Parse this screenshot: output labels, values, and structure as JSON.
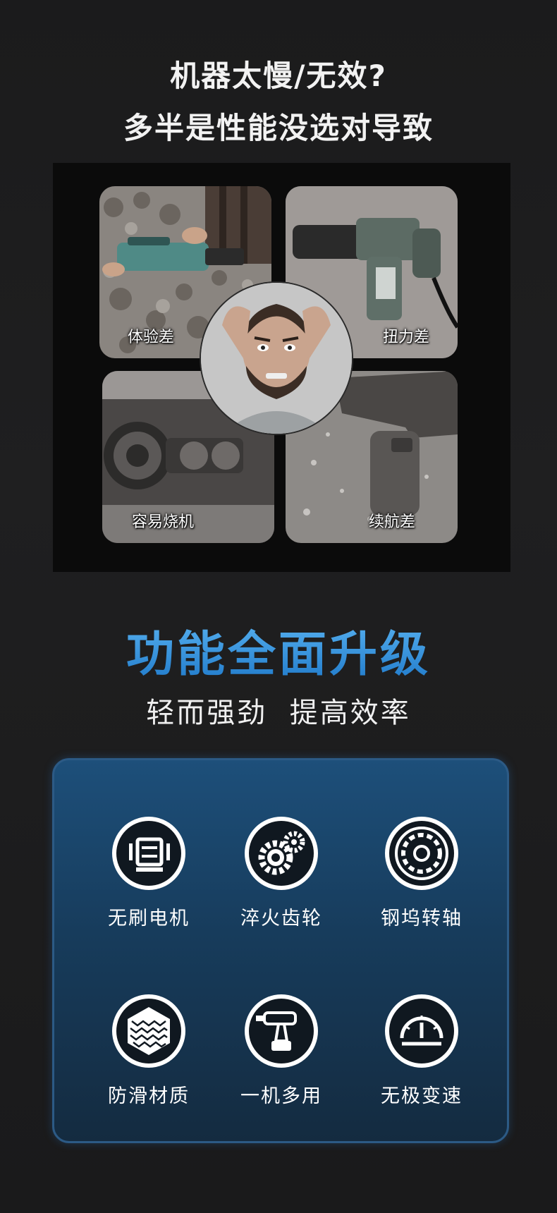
{
  "headline": {
    "line1": "机器太慢/无效?",
    "line2": "多半是性能没选对导致"
  },
  "problems": [
    {
      "label": "体验差"
    },
    {
      "label": "扭力差"
    },
    {
      "label": "容易烧机"
    },
    {
      "label": "续航差"
    }
  ],
  "upgrade": {
    "title": "功能全面升级",
    "subtitle": "轻而强劲  提高效率"
  },
  "features": [
    {
      "label": "无刷电机",
      "icon": "brushless-motor-icon"
    },
    {
      "label": "淬火齿轮",
      "icon": "gears-icon"
    },
    {
      "label": "钢坞转轴",
      "icon": "bearing-icon"
    },
    {
      "label": "防滑材质",
      "icon": "anti-slip-texture-icon"
    },
    {
      "label": "一机多用",
      "icon": "impact-drill-icon"
    },
    {
      "label": "无极变速",
      "icon": "speed-gauge-icon"
    }
  ],
  "colors": {
    "background": "#1b1b1c",
    "accent_blue": "#2f8fdc",
    "panel_blue": "#1d4f7a"
  }
}
